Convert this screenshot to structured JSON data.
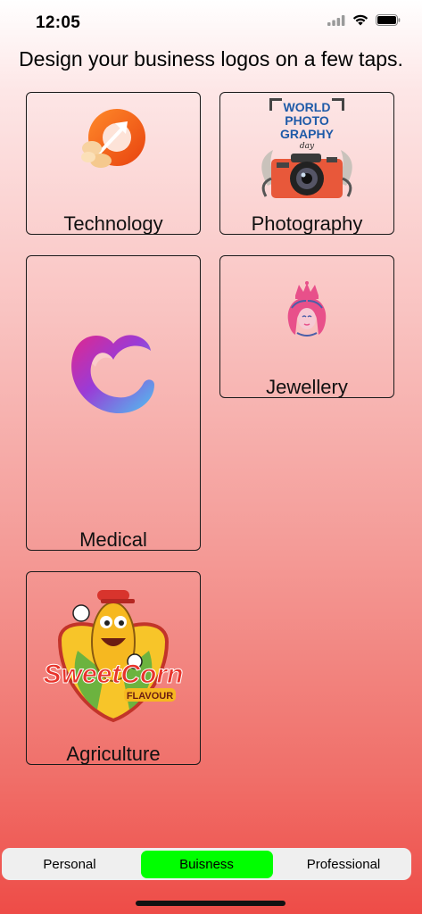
{
  "status_bar": {
    "time": "12:05",
    "icons": [
      "signal-icon",
      "wifi-icon",
      "battery-icon"
    ]
  },
  "headline": "Design your business logos on a few taps.",
  "categories": [
    {
      "label": "Technology"
    },
    {
      "label": "Photography",
      "logo_text": [
        "WORLD",
        "PHOTO",
        "GRAPHY",
        "day"
      ]
    },
    {
      "label": "Medical"
    },
    {
      "label": "Jewellery"
    },
    {
      "label": "Agriculture",
      "logo_text": [
        "SweetCorn",
        "FLAVOUR"
      ]
    }
  ],
  "tabs": [
    {
      "label": "Personal",
      "active": false
    },
    {
      "label": "Buisness",
      "active": true
    },
    {
      "label": "Professional",
      "active": false
    }
  ],
  "colors": {
    "active_tab": "#00ff00",
    "tabbar_bg": "#efefef",
    "gradient_top": "#ffffff",
    "gradient_bottom": "#ee4c47"
  }
}
